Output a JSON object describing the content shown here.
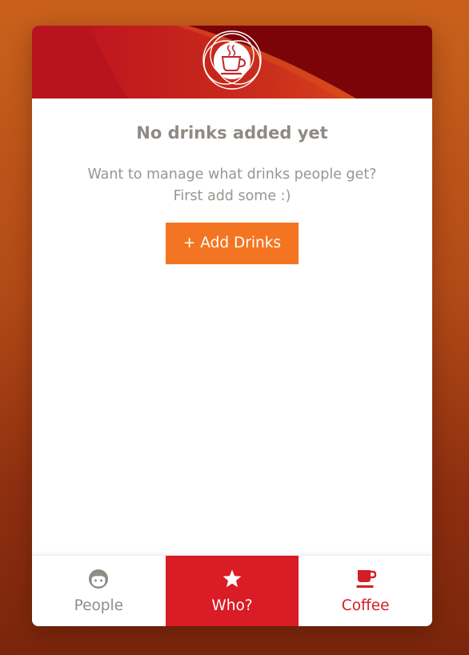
{
  "empty_state": {
    "title": "No drinks added yet",
    "message_line1": "Want to manage what drinks people get?",
    "message_line2": "First add some :)",
    "add_button_label": "+ Add Drinks"
  },
  "tabs": [
    {
      "label": "People",
      "icon": "face-icon",
      "active": false
    },
    {
      "label": "Who?",
      "icon": "star-icon",
      "active": true
    },
    {
      "label": "Coffee",
      "icon": "coffee-cup-icon",
      "active": false
    }
  ],
  "colors": {
    "accent_red": "#d91c25",
    "button_orange": "#f47521",
    "header_dark": "#7b0409",
    "text_gray": "#9a958f"
  }
}
